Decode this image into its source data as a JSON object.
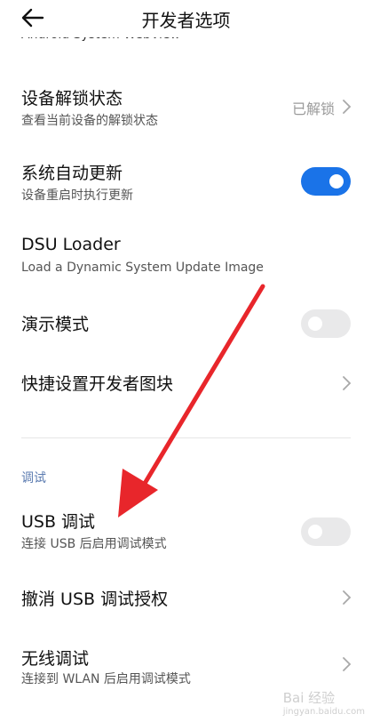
{
  "header": {
    "title": "开发者选项",
    "back_icon": "back-arrow-icon"
  },
  "cut_row": {
    "text": "Android System WebView"
  },
  "rows": [
    {
      "title": "设备解锁状态",
      "subtitle": "查看当前设备的解锁状态",
      "value": "已解锁"
    },
    {
      "title": "系统自动更新",
      "subtitle": "设备重启时执行更新",
      "toggle": "on"
    },
    {
      "title": "DSU Loader",
      "subtitle": "Load a Dynamic System Update Image"
    },
    {
      "title": "演示模式",
      "toggle": "off"
    },
    {
      "title": "快捷设置开发者图块"
    }
  ],
  "section": {
    "label": "调试"
  },
  "debug_rows": [
    {
      "title": "USB 调试",
      "subtitle": "连接 USB 后启用调试模式",
      "toggle": "off"
    },
    {
      "title": "撤消 USB 调试授权"
    },
    {
      "title": "无线调试",
      "subtitle": "连接到 WLAN 后启用调试模式"
    }
  ],
  "watermark": {
    "text": "Bai 经验",
    "sub": "jingyan.baidu.com"
  },
  "colors": {
    "accent": "#1a73e8",
    "annotation_arrow": "#e8262b",
    "section": "#5b7bb0"
  }
}
